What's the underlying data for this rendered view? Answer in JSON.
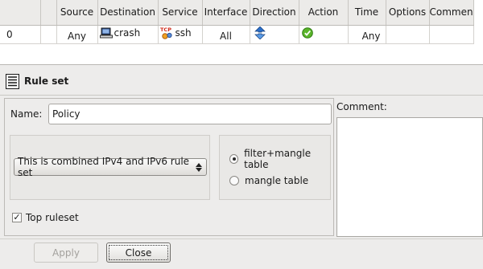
{
  "rules_table": {
    "columns": [
      "Source",
      "Destination",
      "Service",
      "Interface",
      "Direction",
      "Action",
      "Time",
      "Options",
      "Comment"
    ],
    "rows": [
      {
        "number": "0",
        "source": "Any",
        "destination": "crash",
        "destination_icon": "host-icon",
        "service": "ssh",
        "service_icon": "tcp-service-icon",
        "service_icon_text": "TCP",
        "interface": "All",
        "direction_icon": "both-directions-icon",
        "action_icon": "accept-icon",
        "time": "Any",
        "options": "",
        "comment": ""
      }
    ]
  },
  "ruleset_panel": {
    "title": "Rule set",
    "icon": "ruleset-icon",
    "name_label": "Name:",
    "name_value": "Policy",
    "address_family_selected": "This is combined IPv4 and IPv6 rule set",
    "table_options": [
      {
        "label": "filter+mangle table",
        "checked": true
      },
      {
        "label": "mangle table",
        "checked": false
      }
    ],
    "top_ruleset_label": "Top ruleset",
    "top_ruleset_checked": true,
    "comment_label": "Comment:",
    "comment_value": ""
  },
  "buttons": {
    "apply_label": "Apply",
    "close_label": "Close"
  },
  "colors": {
    "window_bg": "#edeceb",
    "accept_green": "#5ab52a",
    "direction_blue": "#2a6fc9",
    "tcp_red": "#d02a1a"
  }
}
